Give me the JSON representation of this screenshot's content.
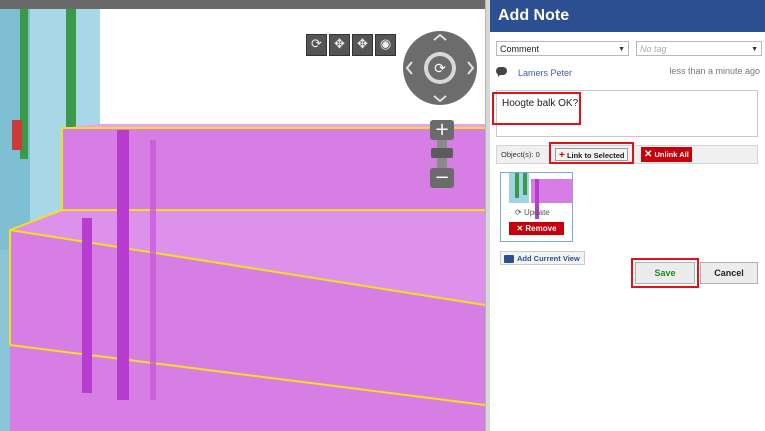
{
  "viewer": {
    "toolbar_icons": [
      "orbit-icon",
      "pan-icon",
      "walk-icon",
      "look-icon"
    ],
    "zoom": {
      "plus": "+",
      "minus": "−"
    },
    "colors": {
      "beam": "#d67ee3",
      "outline": "#f0e21a",
      "column": "#8ac8dc",
      "slab": "#88d88c",
      "rebar": "#c040d0"
    }
  },
  "panel": {
    "title": "Add Note",
    "type_select": "Comment",
    "tag_placeholder": "No tag",
    "author": "Lamers Peter",
    "timestamp": "less than a minute ago",
    "note_text": "Hoogte balk OK?",
    "objects_label": "Object(s): 0",
    "link_button": "Link to Selected",
    "unlink_button": "Unlink All",
    "update_button": "Update",
    "remove_button": "Remove",
    "add_view_button": "Add Current View",
    "save_button": "Save",
    "cancel_button": "Cancel",
    "colors": {
      "header": "#2c4f91",
      "danger": "#c8000c",
      "highlight": "#e0131a",
      "save": "#1d8a1d"
    }
  }
}
